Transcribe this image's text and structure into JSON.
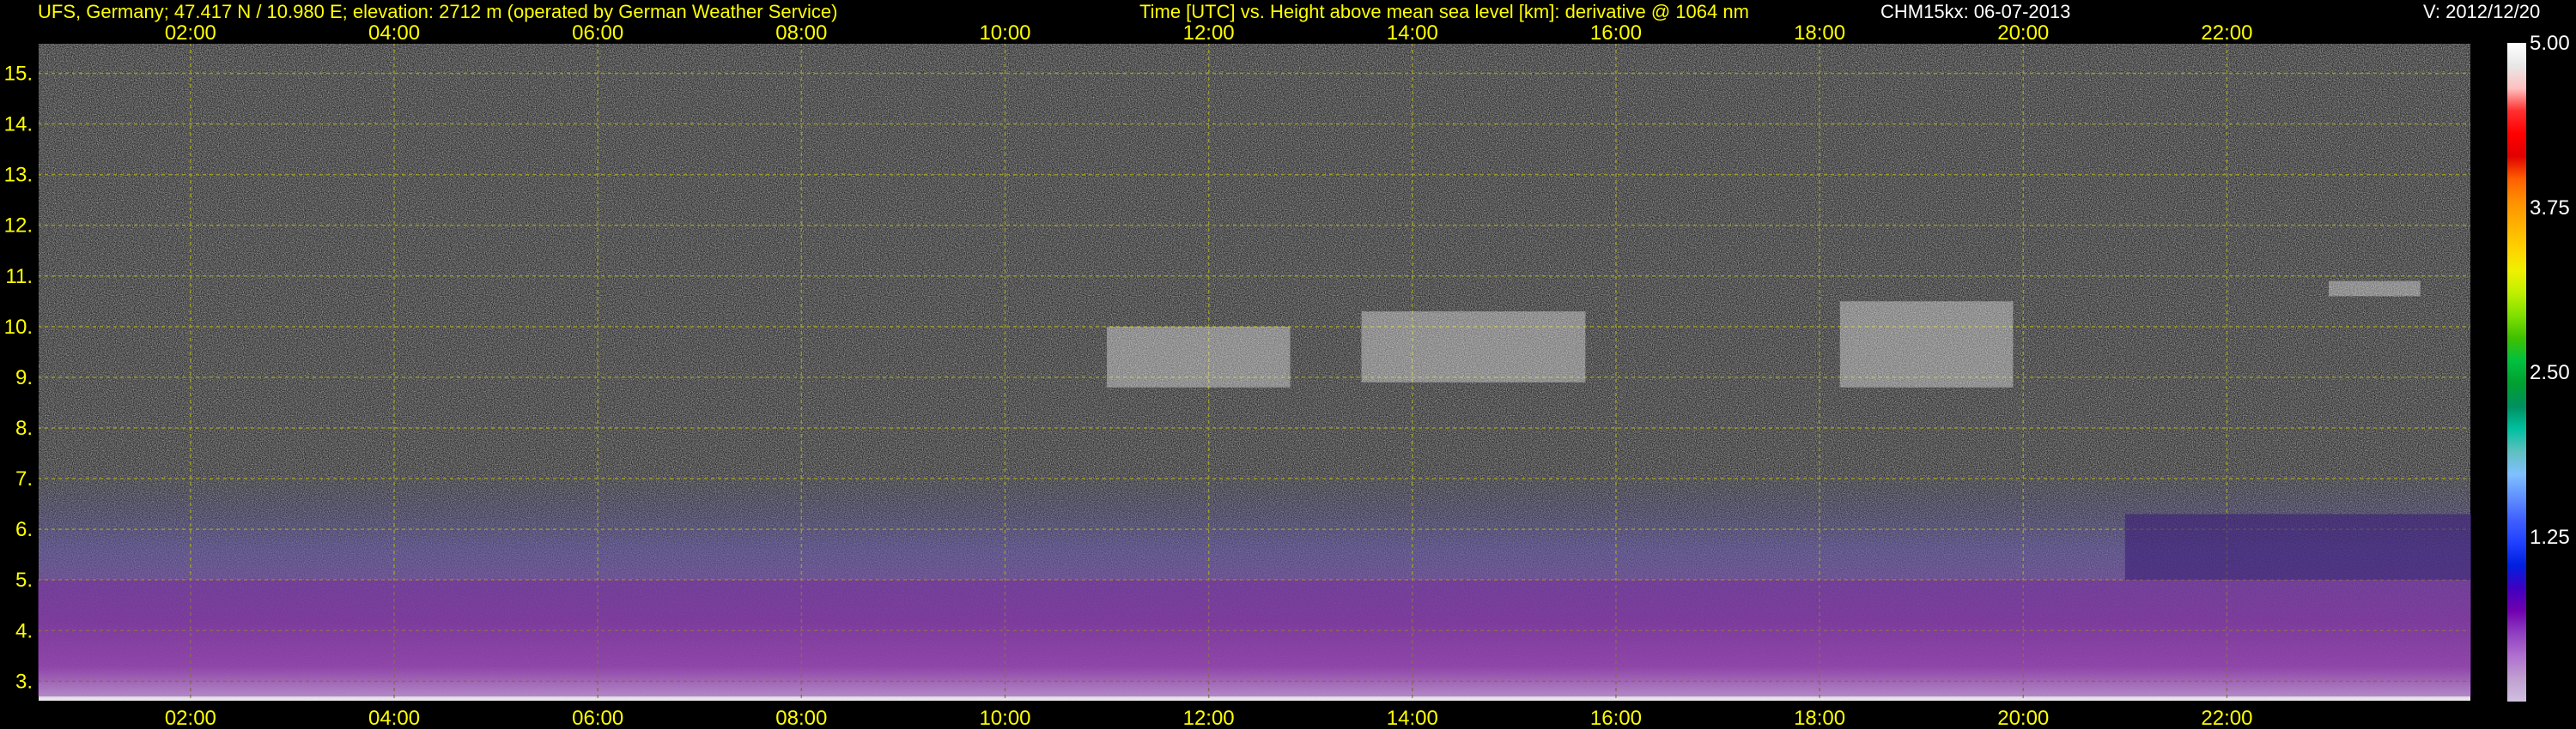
{
  "header": {
    "site": "UFS, Germany; 47.417 N / 10.980 E; elevation: 2712 m  (operated by German Weather Service)",
    "axes_desc": "Time [UTC] vs. Height above mean sea level [km]: derivative @ 1064 nm",
    "instrument": "CHM15kx: 06-07-2013",
    "version": "V: 2012/12/20"
  },
  "colors": {
    "text": "#ffff00",
    "gridline": "#9a9a2a",
    "background": "#000000"
  },
  "chart_data": {
    "type": "heatmap",
    "x_axis": {
      "unit": "UTC",
      "range": [
        0.5,
        24.4
      ],
      "ticks": [
        "02:00",
        "04:00",
        "06:00",
        "08:00",
        "10:00",
        "12:00",
        "14:00",
        "16:00",
        "18:00",
        "20:00",
        "22:00"
      ]
    },
    "y_axis": {
      "unit": "km",
      "range": [
        2.6,
        15.6
      ],
      "ticks": [
        "3.",
        "4.",
        "5.",
        "6.",
        "7.",
        "8.",
        "9.",
        "10.",
        "11.",
        "12.",
        "13.",
        "14.",
        "15."
      ]
    },
    "grid": true,
    "colorbar": {
      "position": "right",
      "range": [
        0,
        5
      ],
      "ticks": [
        "5.00",
        "3.75",
        "2.50",
        "1.25"
      ],
      "colors": [
        "#ffffff",
        "#e8e8e8",
        "#ffc0c0",
        "#ff3030",
        "#ff0000",
        "#e00000",
        "#ff6000",
        "#ff9000",
        "#ffb000",
        "#ffd000",
        "#f0f000",
        "#c0f000",
        "#80e000",
        "#40c000",
        "#00c040",
        "#00a030",
        "#009060",
        "#00c0a0",
        "#60c0c0",
        "#80c0ff",
        "#6090ff",
        "#4060ff",
        "#2040ff",
        "#0020e0",
        "#4000c0",
        "#7000b0",
        "#9040c0",
        "#b070d0",
        "#c0a0d0",
        "#d0c0e0"
      ]
    },
    "features": [
      {
        "kind": "boundary-layer-aerosol",
        "time": [
          0.5,
          24.4
        ],
        "height_km": [
          2.7,
          5.0
        ]
      },
      {
        "kind": "cirrus-cloud",
        "time": [
          11.0,
          12.8
        ],
        "height_km": [
          8.8,
          10.0
        ]
      },
      {
        "kind": "cirrus-cloud",
        "time": [
          13.5,
          15.7
        ],
        "height_km": [
          8.9,
          10.3
        ]
      },
      {
        "kind": "cirrus-cloud",
        "time": [
          18.2,
          19.9
        ],
        "height_km": [
          8.8,
          10.5
        ]
      },
      {
        "kind": "cirrus-cloud",
        "time": [
          23.0,
          23.9
        ],
        "height_km": [
          10.6,
          10.9
        ]
      },
      {
        "kind": "aerosol-layer",
        "time": [
          21.0,
          24.4
        ],
        "height_km": [
          5.0,
          6.3
        ]
      }
    ]
  }
}
